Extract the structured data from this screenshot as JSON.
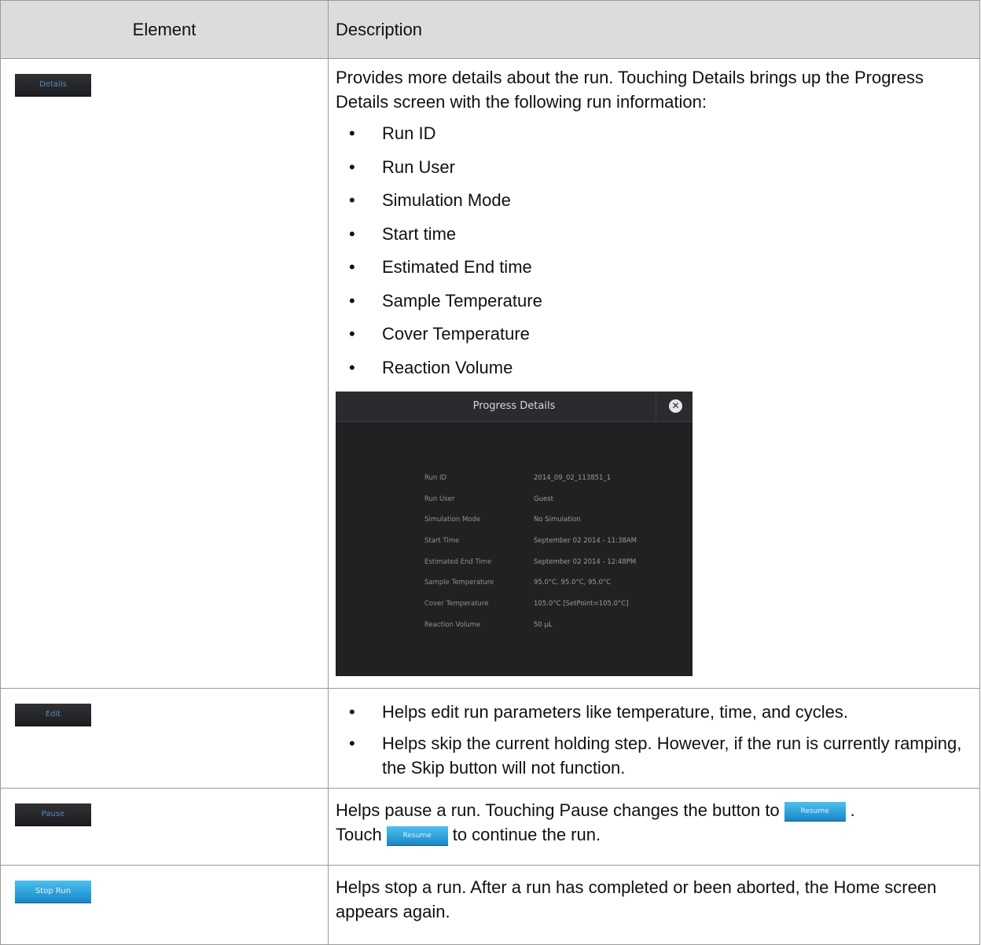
{
  "header": {
    "element": "Element",
    "description": "Description"
  },
  "rows": [
    {
      "button": "Details",
      "intro": "Provides more details about the run. Touching Details brings up the Progress Details screen with the following run information:",
      "items": [
        "Run ID",
        "Run User",
        "Simulation Mode",
        "Start time",
        "Estimated End time",
        "Sample Temperature",
        "Cover Temperature",
        "Reaction Volume"
      ],
      "screen": {
        "title": "Progress Details",
        "close": "✕",
        "fields": [
          {
            "k": "Run ID",
            "v": "2014_09_02_113851_1"
          },
          {
            "k": "Run User",
            "v": "Guest"
          },
          {
            "k": "Simulation Mode",
            "v": "No Simulation"
          },
          {
            "k": "Start Time",
            "v": "September 02 2014 - 11:38AM"
          },
          {
            "k": "Estimated End Time",
            "v": "September 02 2014 - 12:48PM"
          },
          {
            "k": "Sample Temperature",
            "v": "95.0°C, 95.0°C, 95.0°C"
          },
          {
            "k": "Cover Temperature",
            "v": "105.0°C [SetPoint=105.0°C]"
          },
          {
            "k": "Reaction Volume",
            "v": "50 µL"
          }
        ]
      }
    },
    {
      "button": "Edit",
      "items": [
        "Helps edit run parameters like temperature, time, and cycles.",
        "Helps skip the current holding step. However, if the run is currently ramping, the Skip button will not function."
      ]
    },
    {
      "button": "Pause",
      "text_a": "Helps pause a run. Touching Pause changes the button to",
      "resume": "Resume",
      "text_b": ".",
      "text_c": "Touch",
      "text_d": "to continue the run."
    },
    {
      "button": "Stop Run",
      "text": "Helps stop a run. After a run has completed or been aborted, the Home screen appears again."
    }
  ]
}
